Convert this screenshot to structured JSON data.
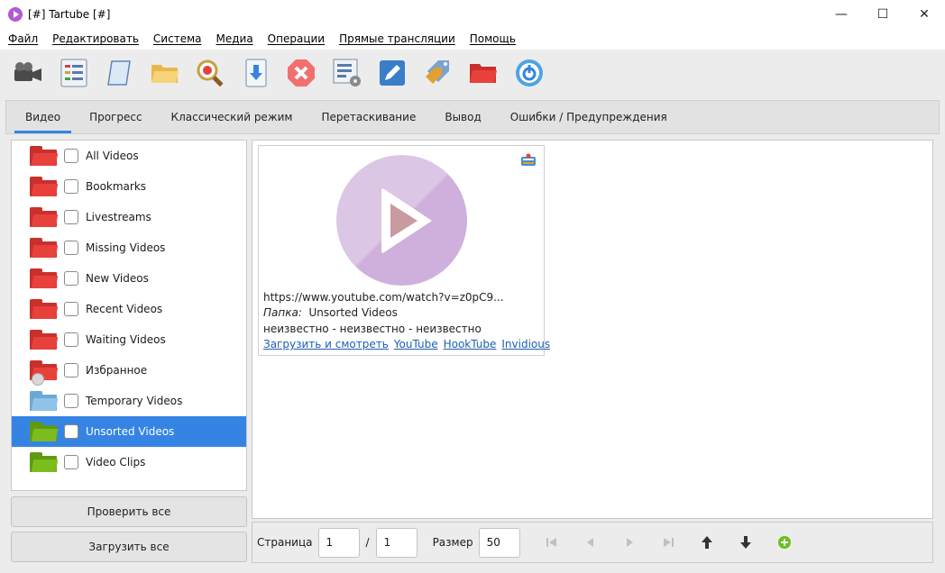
{
  "window": {
    "title": "[#] Tartube [#]",
    "controls": {
      "minimize": "—",
      "maximize": "☐",
      "close": "✕"
    }
  },
  "menu": [
    "Файл",
    "Редактировать",
    "Система",
    "Медиа",
    "Операции",
    "Прямые трансляции",
    "Помощь"
  ],
  "toolbar": [
    "video-camera-icon",
    "list-icon",
    "scroll-icon",
    "folder-open-icon",
    "search-magnifier-icon",
    "download-icon",
    "stop-icon",
    "checklist-settings-icon",
    "edit-pencil-icon",
    "tags-icon",
    "red-folder-icon",
    "power-icon"
  ],
  "tabs": [
    "Видео",
    "Прогресс",
    "Классический режим",
    "Перетаскивание",
    "Вывод",
    "Ошибки / Предупреждения"
  ],
  "folders": [
    {
      "label": "All Videos",
      "color": "red"
    },
    {
      "label": "Bookmarks",
      "color": "red"
    },
    {
      "label": "Livestreams",
      "color": "red"
    },
    {
      "label": "Missing Videos",
      "color": "red"
    },
    {
      "label": "New Videos",
      "color": "red"
    },
    {
      "label": "Recent Videos",
      "color": "red"
    },
    {
      "label": "Waiting Videos",
      "color": "red"
    },
    {
      "label": "Избранное",
      "color": "red"
    },
    {
      "label": "Temporary Videos",
      "color": "blue"
    },
    {
      "label": "Unsorted Videos",
      "color": "green"
    },
    {
      "label": "Video Clips",
      "color": "green"
    }
  ],
  "left_buttons": {
    "check_all": "Проверить все",
    "download_all": "Загрузить все"
  },
  "video": {
    "url": "https://www.youtube.com/watch?v=z0pC9...",
    "folder_label": "Папка:",
    "folder_value": "Unsorted Videos",
    "meta": "неизвестно  -  неизвестно  -  неизвестно",
    "links": [
      "Загрузить и смотреть",
      "YouTube",
      "HookTube",
      "Invidious"
    ]
  },
  "pager": {
    "page_label": "Страница",
    "page": "1",
    "sep": "/",
    "total": "1",
    "size_label": "Размер",
    "size": "50"
  },
  "colors": {
    "accent": "#3584e4",
    "folder_red": "#e8413c",
    "folder_blue": "#8fc3e8",
    "folder_green": "#7cbc1c"
  }
}
